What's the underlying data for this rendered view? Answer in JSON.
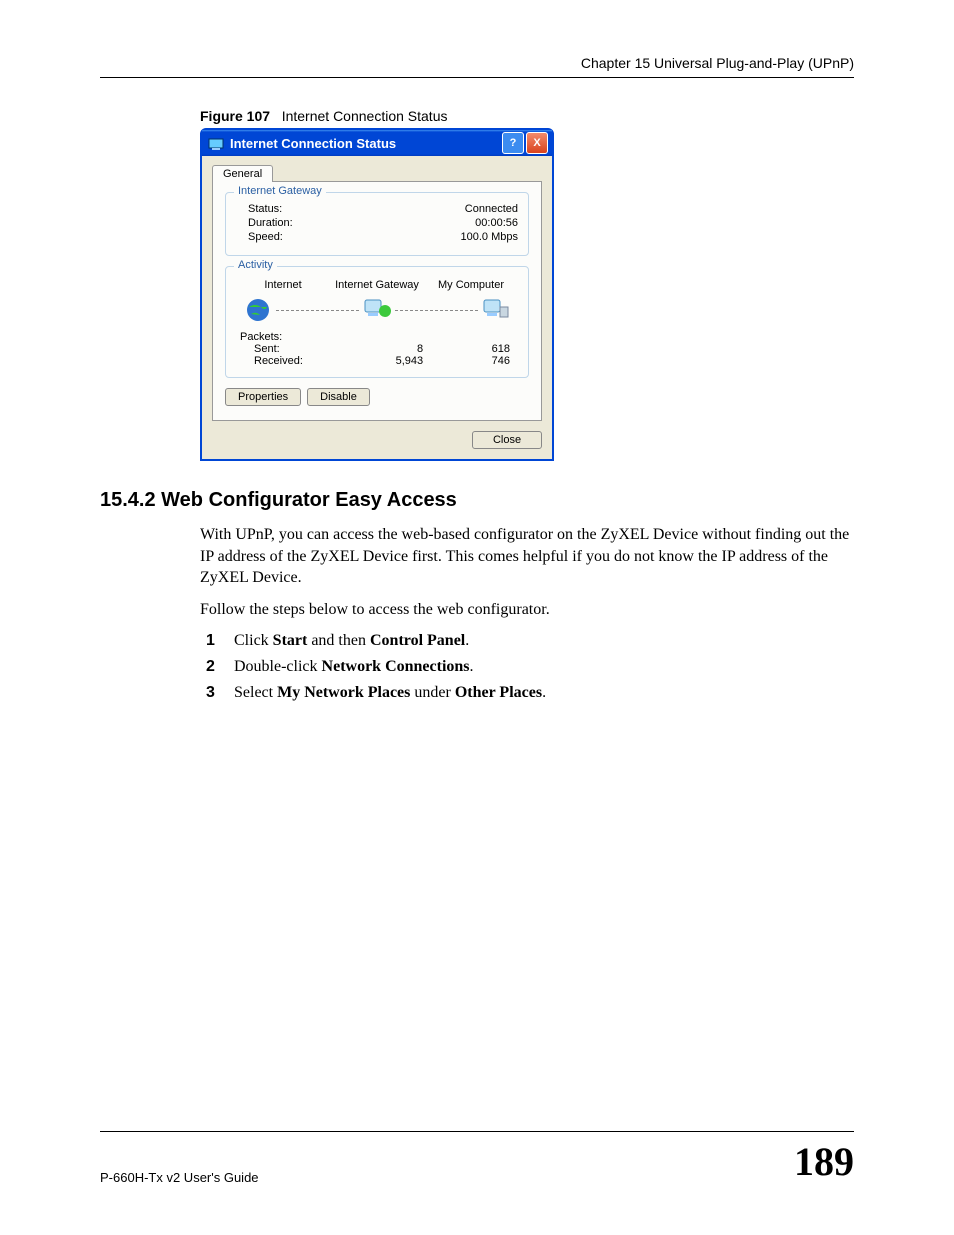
{
  "header": {
    "chapter": "Chapter 15 Universal Plug-and-Play (UPnP)"
  },
  "figure": {
    "label": "Figure 107",
    "caption": "Internet Connection Status"
  },
  "dialog": {
    "title": "Internet Connection Status",
    "help": "?",
    "close_x": "X",
    "tab": "General",
    "gateway": {
      "legend": "Internet Gateway",
      "status_label": "Status:",
      "status_value": "Connected",
      "duration_label": "Duration:",
      "duration_value": "00:00:56",
      "speed_label": "Speed:",
      "speed_value": "100.0 Mbps"
    },
    "activity": {
      "legend": "Activity",
      "col_internet": "Internet",
      "col_gateway": "Internet Gateway",
      "col_mycomputer": "My Computer",
      "packets_label": "Packets:",
      "sent_label": "Sent:",
      "recv_label": "Received:",
      "gw_sent": "8",
      "gw_recv": "5,943",
      "my_sent": "618",
      "my_recv": "746"
    },
    "buttons": {
      "properties": "Properties",
      "disable": "Disable",
      "close": "Close"
    }
  },
  "section": {
    "heading": "15.4.2  Web Configurator Easy Access",
    "para1_a": "With UPnP, you can access the web-based configurator on the ZyXEL Device without finding out the IP address of the ZyXEL Device first. This comes helpful if you do not know the IP address of the ZyXEL Device.",
    "para2": "Follow the steps below to access the web configurator.",
    "step1_a": "Click ",
    "step1_b": "Start",
    "step1_c": " and then ",
    "step1_d": "Control Panel",
    "step1_e": ".",
    "step2_a": "Double-click ",
    "step2_b": "Network Connections",
    "step2_c": ".",
    "step3_a": "Select ",
    "step3_b": "My Network Places",
    "step3_c": " under ",
    "step3_d": "Other Places",
    "step3_e": "."
  },
  "footer": {
    "guide": "P-660H-Tx v2 User's Guide",
    "page": "189"
  }
}
